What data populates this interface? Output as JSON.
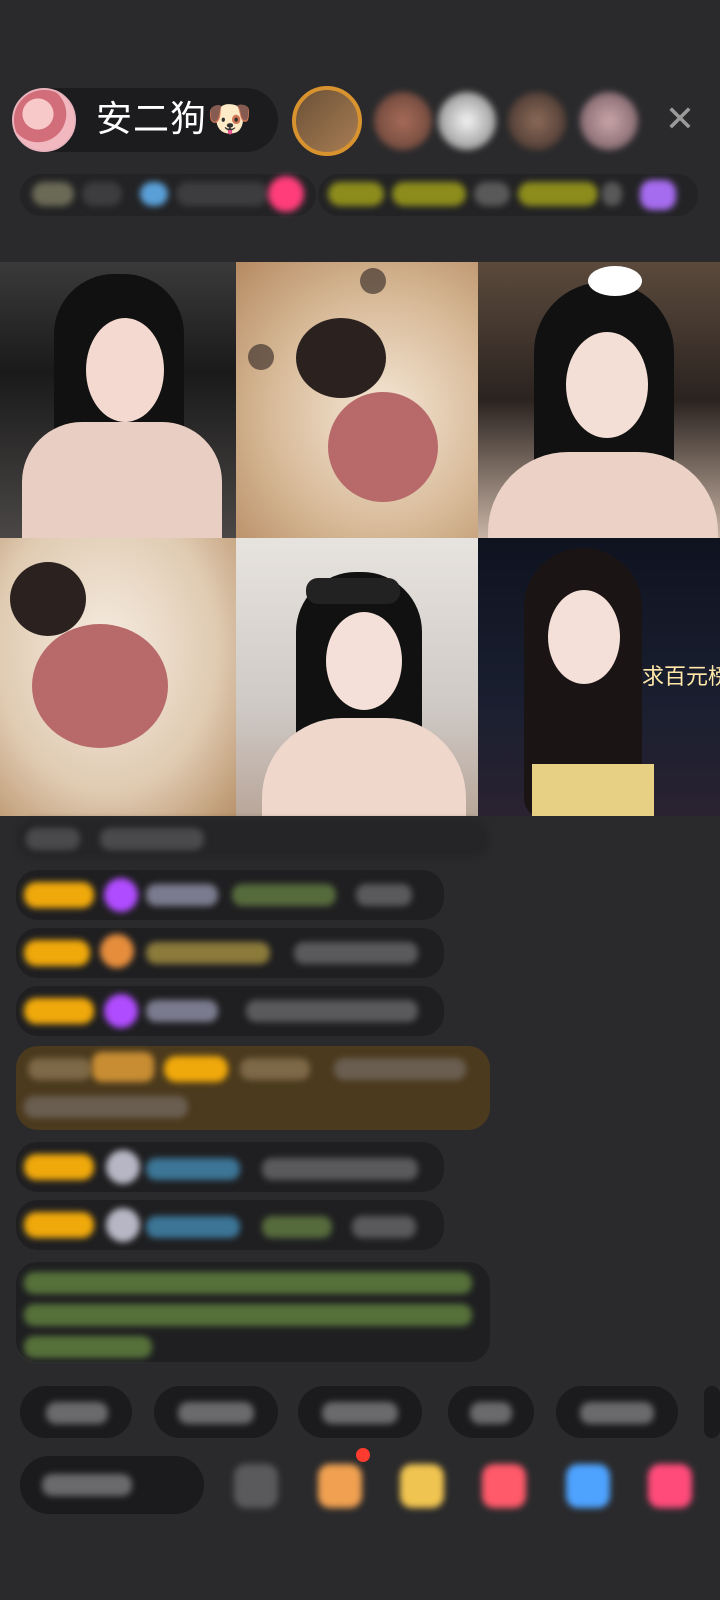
{
  "host": {
    "name": "安二狗🐶"
  },
  "icons": {
    "close": "close-icon",
    "gift": "gift-icon",
    "emoji": "emoji-icon"
  },
  "grid": {
    "caption": "求百元榜T"
  },
  "colors": {
    "background": "#2a2a2c",
    "badge_yellow": "#f0a90b",
    "accent_purple": "#b04cff",
    "chat_text_green": "#7dbb53"
  }
}
